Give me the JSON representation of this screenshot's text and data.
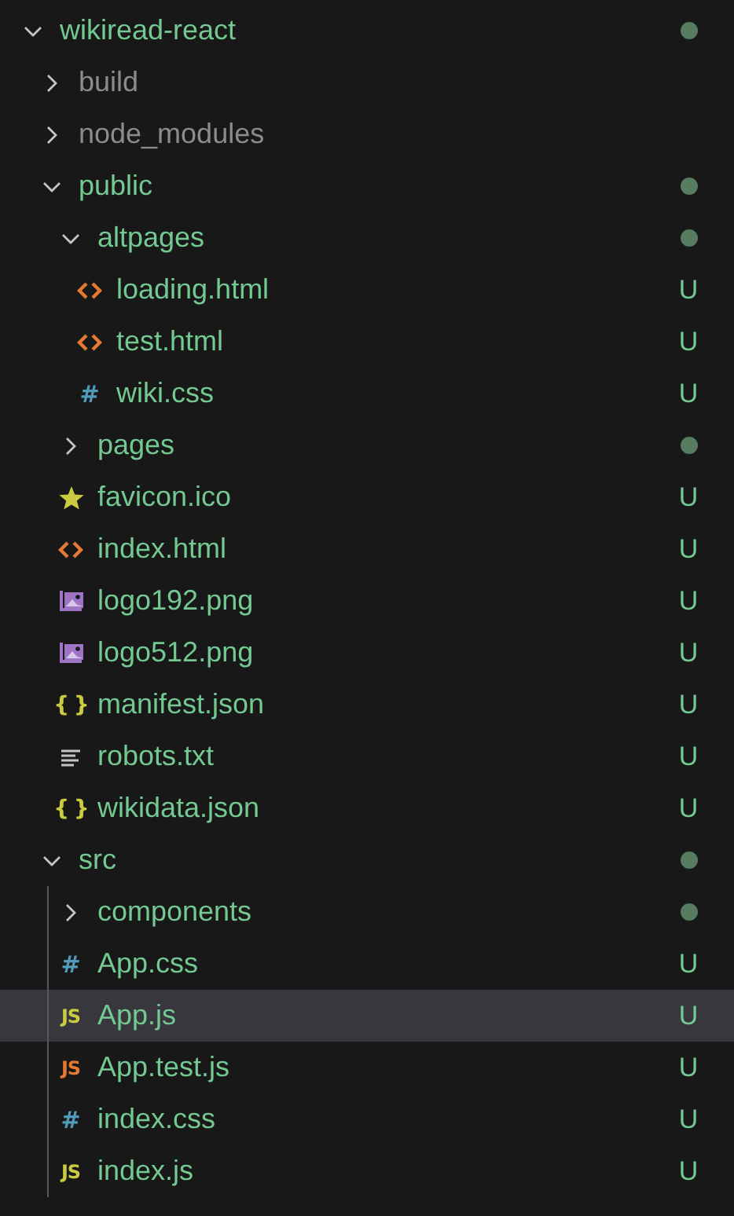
{
  "explorer": {
    "items": [
      {
        "name": "wikiread-react",
        "kind": "folder",
        "expanded": true,
        "modified": true,
        "selected": false,
        "children": [
          {
            "name": "build",
            "kind": "folder",
            "expanded": false,
            "ignored": true,
            "modified": false,
            "selected": false
          },
          {
            "name": "node_modules",
            "kind": "folder",
            "expanded": false,
            "ignored": true,
            "modified": false,
            "selected": false
          },
          {
            "name": "public",
            "kind": "folder",
            "expanded": true,
            "modified": true,
            "selected": false,
            "children": [
              {
                "name": "altpages",
                "kind": "folder",
                "expanded": true,
                "modified": true,
                "selected": false,
                "children": [
                  {
                    "name": "loading.html",
                    "kind": "html",
                    "status": "U",
                    "selected": false
                  },
                  {
                    "name": "test.html",
                    "kind": "html",
                    "status": "U",
                    "selected": false
                  },
                  {
                    "name": "wiki.css",
                    "kind": "css",
                    "glyph": "#",
                    "status": "U",
                    "selected": false
                  }
                ]
              },
              {
                "name": "pages",
                "kind": "folder",
                "expanded": false,
                "modified": true,
                "selected": false
              },
              {
                "name": "favicon.ico",
                "kind": "star",
                "status": "U",
                "selected": false
              },
              {
                "name": "index.html",
                "kind": "html",
                "status": "U",
                "selected": false
              },
              {
                "name": "logo192.png",
                "kind": "image",
                "status": "U",
                "selected": false
              },
              {
                "name": "logo512.png",
                "kind": "image",
                "status": "U",
                "selected": false
              },
              {
                "name": "manifest.json",
                "kind": "json",
                "glyph": "{ }",
                "status": "U",
                "selected": false
              },
              {
                "name": "robots.txt",
                "kind": "text",
                "status": "U",
                "selected": false
              },
              {
                "name": "wikidata.json",
                "kind": "json",
                "glyph": "{ }",
                "status": "U",
                "selected": false
              }
            ]
          },
          {
            "name": "src",
            "kind": "folder",
            "expanded": true,
            "modified": true,
            "selected": false,
            "children": [
              {
                "name": "components",
                "kind": "folder",
                "expanded": false,
                "modified": true,
                "selected": false
              },
              {
                "name": "App.css",
                "kind": "css",
                "glyph": "#",
                "status": "U",
                "selected": false
              },
              {
                "name": "App.js",
                "kind": "js",
                "glyph": "JS",
                "status": "U",
                "selected": true
              },
              {
                "name": "App.test.js",
                "kind": "testjs",
                "glyph": "JS",
                "status": "U",
                "selected": false
              },
              {
                "name": "index.css",
                "kind": "css",
                "glyph": "#",
                "status": "U",
                "selected": false
              },
              {
                "name": "index.js",
                "kind": "js",
                "glyph": "JS",
                "status": "U",
                "selected": false
              }
            ]
          }
        ]
      }
    ]
  }
}
